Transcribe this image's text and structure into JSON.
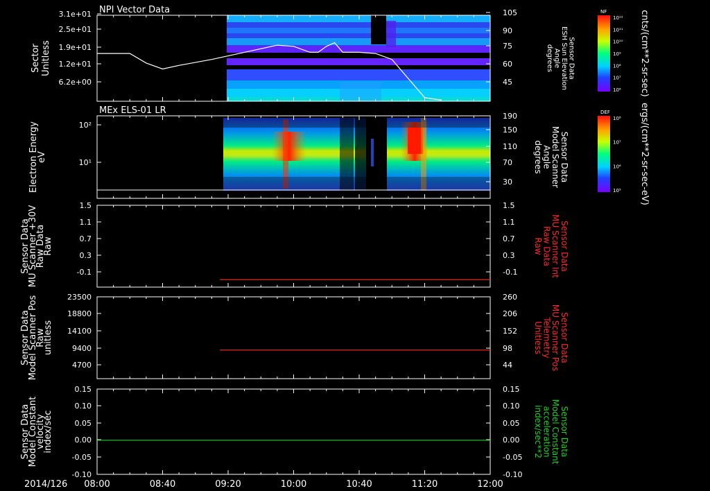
{
  "date_label": "2014/126",
  "x_ticks": [
    "08:00",
    "08:40",
    "09:20",
    "10:00",
    "10:40",
    "11:20",
    "12:00"
  ],
  "colors": {
    "red": "#ff2a2a",
    "green": "#22d022",
    "white": "#ffffff"
  },
  "panels": [
    {
      "id": "sector",
      "title": "NPI Vector Data",
      "left_ylabel": [
        "Sector",
        "Unitless"
      ],
      "left_ticks": [
        "3.1e+01",
        "2.5e+01",
        "1.9e+01",
        "1.2e+01",
        "6.2e+00"
      ],
      "right_ticks": [
        "105",
        "90",
        "75",
        "60",
        "45"
      ],
      "right_label": [
        "Sensor Data",
        "ESH Sun Elevation",
        "Angle",
        "degrees"
      ],
      "cbar_title": "NF",
      "cbar_ticks": [
        "10¹²",
        "10¹¹",
        "10¹⁰",
        "10⁹",
        "10⁸",
        "10⁷",
        "10⁶"
      ],
      "cbar_unit": "cnts/(cm**2-sr-sec)"
    },
    {
      "id": "els",
      "title": "MEx ELS-01 LR",
      "left_ylabel": [
        "Electron Energy",
        "eV"
      ],
      "left_ticks": [
        "10²",
        "10¹"
      ],
      "right_ticks": [
        "190",
        "150",
        "110",
        "70",
        "30"
      ],
      "right_label": [
        "Sensor Data",
        "Model Scanner",
        "Angle",
        "degrees"
      ],
      "cbar_title": "DEF",
      "cbar_ticks": [
        "10⁸",
        "10⁷",
        "10⁶",
        "10⁵"
      ],
      "cbar_unit": "ergs/(cm**2-sr-sec-eV)"
    },
    {
      "id": "mu_int",
      "left_ylabel": [
        "Sensor Data",
        "MU Scanner +30V",
        "Raw Data",
        "Raw"
      ],
      "left_ticks": [
        "1.5",
        "1.1",
        "0.7",
        "0.3",
        "-0.1"
      ],
      "right_ticks": [
        "1.5",
        "1.1",
        "0.7",
        "0.3",
        "-0.1"
      ],
      "right_label": [
        "Sensor Data",
        "MU Scanner Int",
        "Raw Data",
        "Raw"
      ]
    },
    {
      "id": "mu_pos",
      "left_ylabel": [
        "Sensor Data",
        "Model Scanner Pos",
        "Raw",
        "unitless"
      ],
      "left_ticks": [
        "23500",
        "18800",
        "14100",
        "9400",
        "4700"
      ],
      "right_ticks": [
        "260",
        "206",
        "152",
        "98",
        "44"
      ],
      "right_label": [
        "Sensor Data",
        "MU Scanner Pos",
        "Telemetry",
        "Unitless"
      ]
    },
    {
      "id": "velocity",
      "left_ylabel": [
        "Sensor Data",
        "Model Constant",
        "velocity",
        "index/sec"
      ],
      "left_ticks": [
        "0.15",
        "0.10",
        "0.05",
        "0.00",
        "-0.05",
        "-0.10"
      ],
      "right_ticks": [
        "0.15",
        "0.10",
        "0.05",
        "0.00",
        "-0.05",
        "-0.10"
      ],
      "right_label": [
        "Sensor Data",
        "Model Constant",
        "acceleration",
        "index/sec**2"
      ]
    }
  ],
  "chart_data": {
    "type": "line",
    "x_range": [
      "08:00",
      "12:00"
    ],
    "series": [
      {
        "panel": "sector",
        "axis": "right",
        "color": "#ffffff",
        "x": [
          "08:00",
          "08:20",
          "08:30",
          "08:40",
          "08:50",
          "09:10",
          "09:30",
          "09:50",
          "10:00",
          "10:10",
          "10:15",
          "10:20",
          "10:25",
          "10:30",
          "10:40",
          "10:50",
          "11:00",
          "11:10",
          "11:20",
          "11:30"
        ],
        "y": [
          73,
          73,
          65,
          60,
          63,
          68,
          74,
          80,
          79,
          74,
          74,
          79,
          82,
          74,
          74,
          73,
          68,
          52,
          36,
          34
        ]
      },
      {
        "panel": "mu_int",
        "color": "#ff2a2a",
        "x": [
          "09:15",
          "12:00"
        ],
        "y": [
          -0.09,
          -0.09
        ]
      },
      {
        "panel": "mu_pos",
        "color": "#ff2a2a",
        "x": [
          "09:15",
          "12:00"
        ],
        "y": [
          8200,
          8200
        ]
      },
      {
        "panel": "velocity",
        "color": "#22d022",
        "x": [
          "08:00",
          "12:00"
        ],
        "y": [
          0.0,
          0.0
        ]
      }
    ],
    "spectrogram_coverage": [
      [
        "09:20",
        "12:00"
      ],
      [
        "09:14",
        "12:00"
      ]
    ]
  }
}
